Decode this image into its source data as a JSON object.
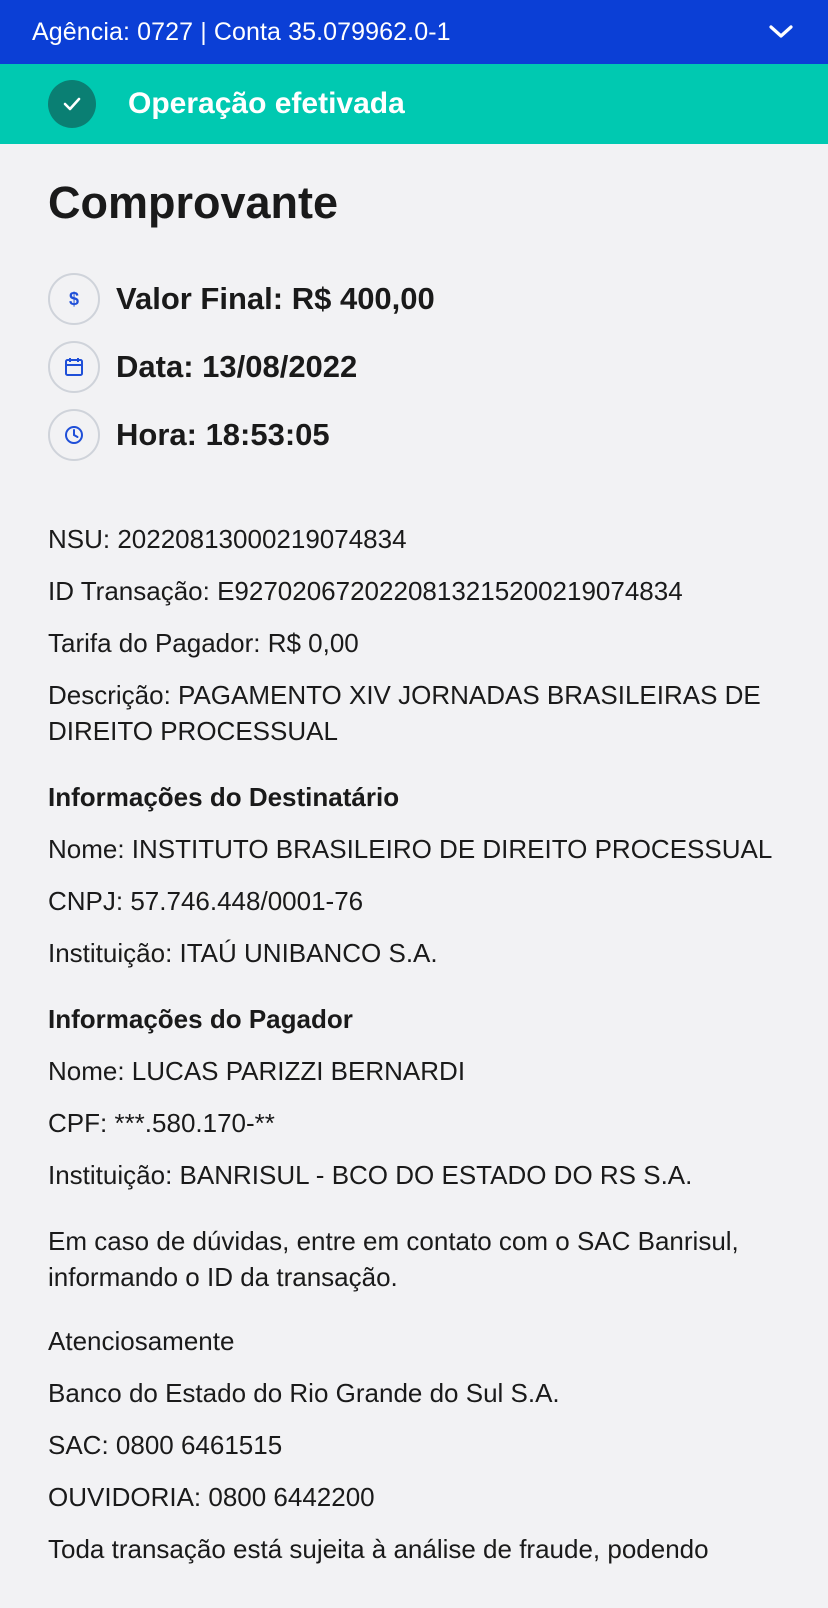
{
  "header": {
    "account_text": "Agência: 0727 | Conta 35.079962.0-1",
    "chevron_icon": "chevron-down-icon"
  },
  "status": {
    "message": "Operação efetivada",
    "icon": "check-icon",
    "colors": {
      "bar": "#00c9b1",
      "icon_bg": "#0a7f73",
      "header": "#0b3fd6"
    }
  },
  "receipt": {
    "title": "Comprovante",
    "summary": {
      "valor": "Valor Final: R$ 400,00",
      "data": "Data: 13/08/2022",
      "hora": "Hora: 18:53:05"
    },
    "nsu": "NSU: 20220813000219074834",
    "id_transacao": "ID Transação: E92702067202208132152002190748​34",
    "tarifa": "Tarifa do Pagador: R$ 0,00",
    "descricao": "Descrição: PAGAMENTO XIV JORNADAS BRASILEIRAS DE DIREITO PROCESSUAL",
    "destinatario": {
      "heading": "Informações do Destinatário",
      "nome": "Nome: INSTITUTO BRASILEIRO DE DIREITO PROCESSUAL",
      "cnpj": "CNPJ: 57.746.448/0001-76",
      "instituicao": "Instituição: ITAÚ UNIBANCO S.A."
    },
    "pagador": {
      "heading": "Informações do Pagador",
      "nome": "Nome: LUCAS PARIZZI BERNARDI",
      "cpf": "CPF: ***.580.170-**",
      "instituicao": "Instituição: BANRISUL - BCO DO ESTADO DO RS S.A."
    },
    "duvidas": "Em caso de dúvidas, entre em contato com o SAC Banrisul, informando o ID da transação.",
    "atenciosamente": "Atenciosamente",
    "banco": "Banco do Estado do Rio Grande do Sul S.A.",
    "sac": "SAC: 0800 6461515",
    "ouvidoria": "OUVIDORIA: 0800 6442200",
    "cut_text": "Toda transação está sujeita à análise de fraude, podendo"
  }
}
